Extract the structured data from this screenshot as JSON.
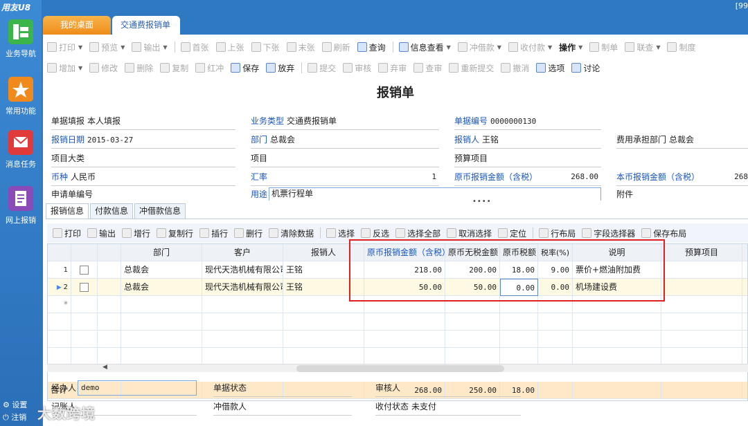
{
  "app": {
    "logo": "用友U8",
    "top_right": "[99"
  },
  "nav": {
    "items": [
      {
        "label": "业务导航",
        "icon": "business-nav-icon"
      },
      {
        "label": "常用功能",
        "icon": "star-icon"
      },
      {
        "label": "消息任务",
        "icon": "message-icon"
      },
      {
        "label": "网上报销",
        "icon": "online-expense-icon"
      }
    ],
    "bottom": {
      "settings": "设置",
      "logout": "注销"
    }
  },
  "tabs": [
    {
      "label": "我的桌面"
    },
    {
      "label": "交通费报销单",
      "close": "×"
    }
  ],
  "toolbar1": [
    "打印",
    "预览",
    "输出",
    "首张",
    "上张",
    "下张",
    "末张",
    "刷新",
    "查询",
    "信息查看",
    "冲借款",
    "收付款",
    "操作",
    "制单",
    "联查",
    "制度"
  ],
  "toolbar2": [
    "增加",
    "修改",
    "删除",
    "复制",
    "红冲",
    "保存",
    "放弃",
    "提交",
    "审核",
    "弃审",
    "查审",
    "重新提交",
    "撤消",
    "选项",
    "讨论"
  ],
  "form": {
    "title": "报销单",
    "fill_mode_label": "单据填报",
    "fill_mode": "本人填报",
    "biz_type_label": "业务类型",
    "biz_type": "交通费报销单",
    "doc_no_label": "单据编号",
    "doc_no": "0000000130",
    "date_label": "报销日期",
    "date": "2015-03-27",
    "dept_label": "部门",
    "dept": "总裁会",
    "reimburser_label": "报销人",
    "reimburser": "王铭",
    "cost_dept_label": "费用承担部门",
    "cost_dept": "总裁会",
    "project_class_label": "项目大类",
    "project_class": "",
    "project_label": "项目",
    "project": "",
    "budget_label": "预算项目",
    "budget": "",
    "currency_label": "币种",
    "currency": "人民币",
    "rate_label": "汇率",
    "rate": "1",
    "orig_amount_label": "原币报销金额（含税）",
    "orig_amount": "268.00",
    "local_amount_label": "本币报销金额（含税）",
    "local_amount": "268",
    "apply_no_label": "申请单编号",
    "purpose_label": "用途",
    "purpose": "机票行程单",
    "attachment_label": "附件",
    "dots": "••••"
  },
  "subtabs": [
    "报销信息",
    "付款信息",
    "冲借款信息"
  ],
  "grid_toolbar": [
    "打印",
    "输出",
    "增行",
    "复制行",
    "插行",
    "删行",
    "清除数据",
    "选择",
    "反选",
    "选择全部",
    "取消选择",
    "定位",
    "行布局",
    "字段选择器",
    "保存布局"
  ],
  "grid": {
    "columns": [
      "部门",
      "客户",
      "报销人",
      "原币报销金额（含税）",
      "原币无税金额",
      "原币税额",
      "税率(%)",
      "说明",
      "预算项目"
    ],
    "rows": [
      {
        "no": "1",
        "dept": "总裁会",
        "customer": "现代天浩机械有限公司",
        "person": "王铭",
        "amount": "218.00",
        "net": "200.00",
        "tax": "18.00",
        "rate": "9.00",
        "desc": "票价+燃油附加费",
        "budget": ""
      },
      {
        "no": "2",
        "dept": "总裁会",
        "customer": "现代天浩机械有限公司",
        "person": "王铭",
        "amount": "50.00",
        "net": "50.00",
        "tax": "0.00",
        "rate": "0.00",
        "desc": "机场建设费",
        "budget": ""
      }
    ],
    "new_row_marker": "*",
    "total_label": "合计",
    "total_amount": "268.00",
    "total_net": "250.00",
    "total_tax": "18.00"
  },
  "bottom": {
    "operator_label": "经办人",
    "operator": "demo",
    "status_label": "单据状态",
    "status": "",
    "auditor_label": "审核人",
    "auditor": "",
    "recorder_label": "记账人",
    "loan_person_label": "冲借款人",
    "pay_status_label": "收付状态",
    "pay_status": "未支付"
  },
  "watermark": "大数跨境",
  "colors": {
    "tab_orange": "#ee8c1a",
    "nav_blue": "#2f79c3",
    "highlight_red": "#e02020",
    "required_blue": "#1a55b8"
  }
}
